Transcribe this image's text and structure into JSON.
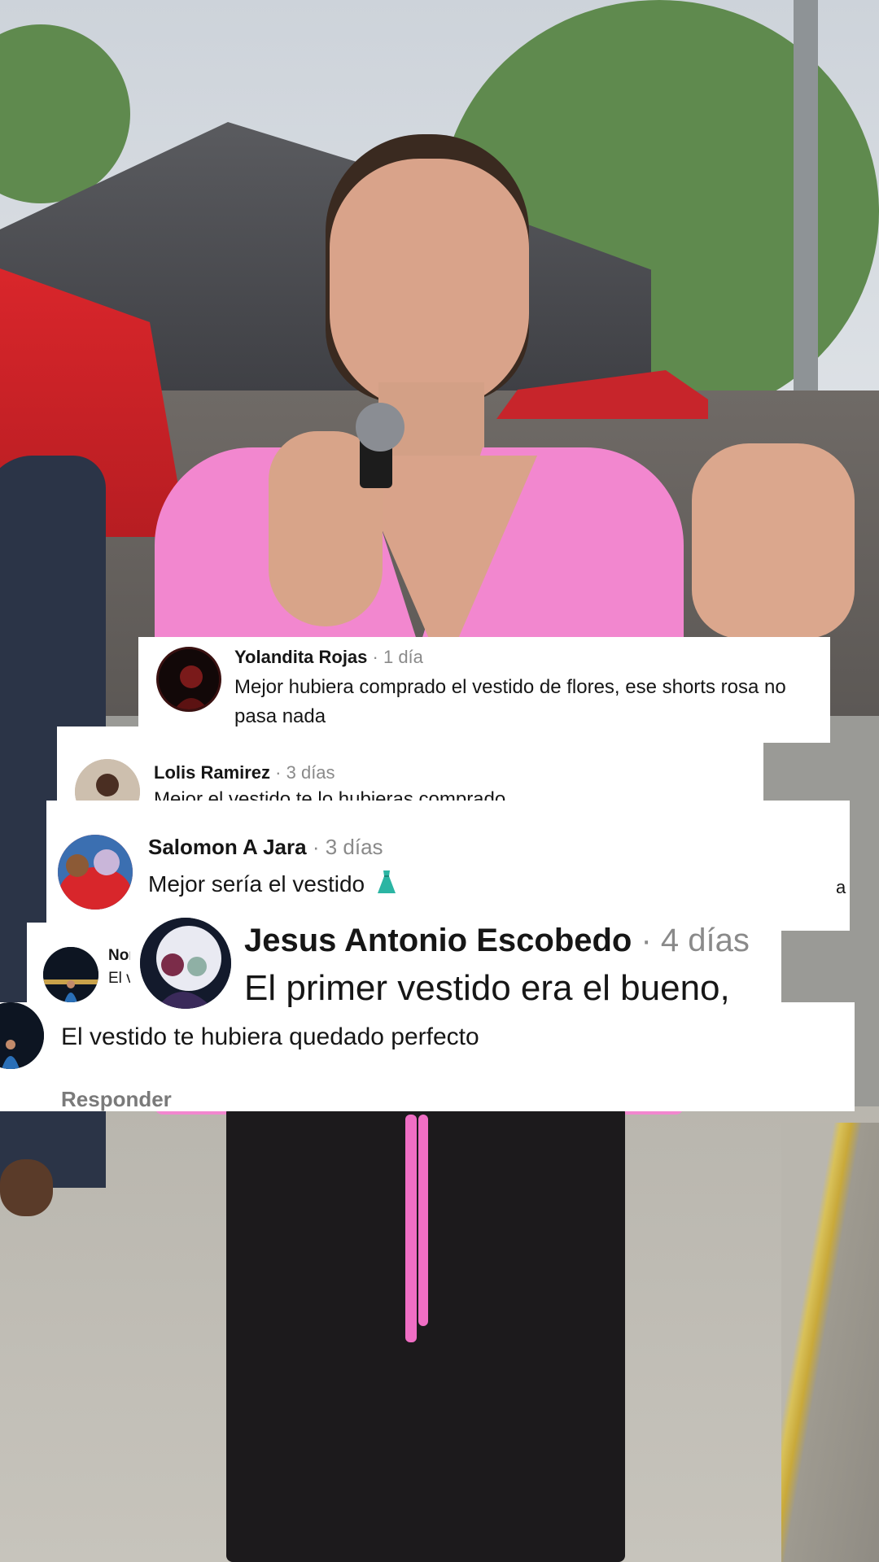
{
  "comments": [
    {
      "author": "Yolandita Rojas",
      "age": "· 1 día",
      "text": "Mejor hubiera comprado el vestido de flores, ese shorts rosa no pasa nada"
    },
    {
      "author": "Lolis Ramirez",
      "age": "· 3 días",
      "text": "Mejor el vestido te lo hubieras comprado"
    },
    {
      "author": "Salomon A Jara",
      "age": "· 3 días",
      "text": "Mejor sería el vestido",
      "icon": "dress-icon",
      "trailing": "a"
    },
    {
      "author": "Norma",
      "author_visible": "Nor",
      "text_visible": "El ve"
    },
    {
      "author": "Jesus Antonio Escobedo",
      "age": "· 4 días",
      "text": "El primer vestido era el bueno,"
    },
    {
      "text": "El vestido te hubiera quedado perfecto",
      "reply_label": "Responder"
    }
  ],
  "colors": {
    "card_bg": "#ffffff",
    "name": "#161616",
    "meta": "#8a8a8a",
    "reply": "#7a7a7a"
  }
}
